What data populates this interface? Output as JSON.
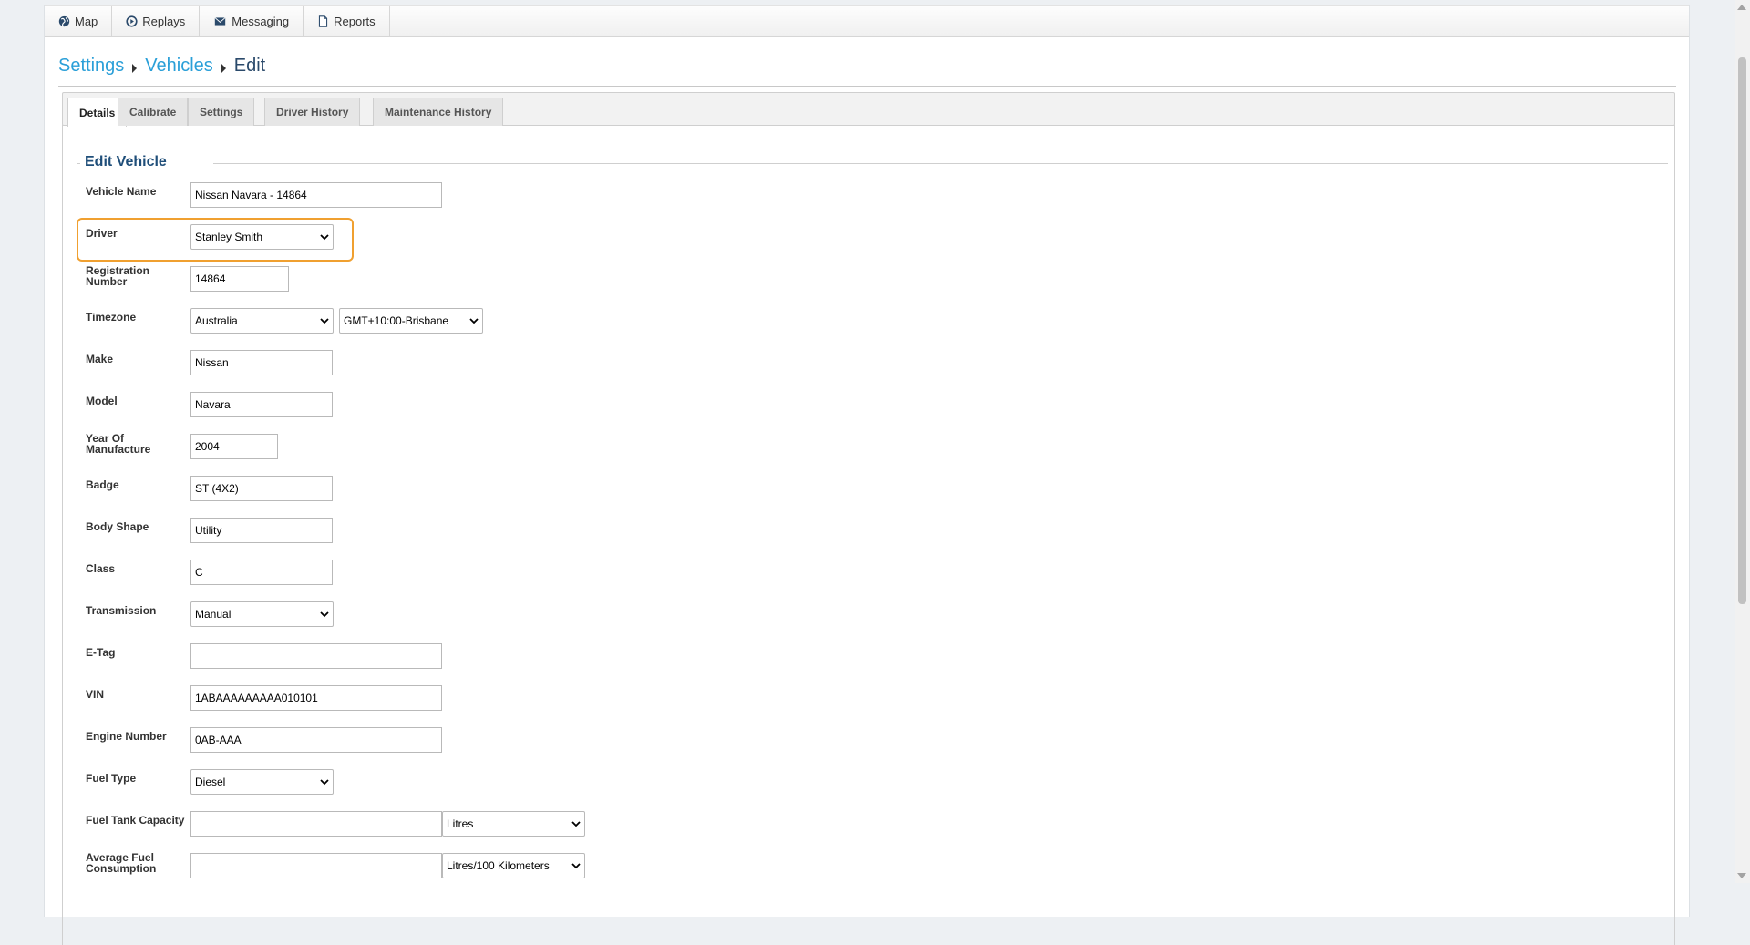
{
  "nav": {
    "items": [
      {
        "label": "Map",
        "icon": "globe-icon"
      },
      {
        "label": "Replays",
        "icon": "play-circle-icon"
      },
      {
        "label": "Messaging",
        "icon": "envelope-icon"
      },
      {
        "label": "Reports",
        "icon": "document-icon"
      }
    ]
  },
  "breadcrumb": {
    "settings": "Settings",
    "vehicles": "Vehicles",
    "current": "Edit"
  },
  "tabs": [
    {
      "label": "Details",
      "active": true
    },
    {
      "label": "Calibrate",
      "active": false
    },
    {
      "label": "Settings",
      "active": false
    },
    {
      "label": "Driver History",
      "active": false
    },
    {
      "label": "Maintenance History",
      "active": false
    }
  ],
  "form": {
    "legend": "Edit Vehicle",
    "vehicle_name": {
      "label": "Vehicle Name",
      "value": "Nissan Navara - 14864"
    },
    "driver": {
      "label": "Driver",
      "value": "Stanley Smith"
    },
    "registration": {
      "label1": "Registration",
      "label2": "Number",
      "value": "14864"
    },
    "timezone": {
      "label": "Timezone",
      "region": "Australia",
      "zone": "GMT+10:00-Brisbane"
    },
    "make": {
      "label": "Make",
      "value": "Nissan"
    },
    "model": {
      "label": "Model",
      "value": "Navara"
    },
    "year": {
      "label1": "Year Of",
      "label2": "Manufacture",
      "value": "2004"
    },
    "badge": {
      "label": "Badge",
      "value": "ST (4X2)"
    },
    "body_shape": {
      "label": "Body Shape",
      "value": "Utility"
    },
    "class": {
      "label": "Class",
      "value": "C"
    },
    "transmission": {
      "label": "Transmission",
      "value": "Manual"
    },
    "etag": {
      "label": "E-Tag",
      "value": ""
    },
    "vin": {
      "label": "VIN",
      "value": "1ABAAAAAAAAA010101"
    },
    "engine_number": {
      "label": "Engine Number",
      "value": "0AB-AAA"
    },
    "fuel_type": {
      "label": "Fuel Type",
      "value": "Diesel"
    },
    "fuel_tank": {
      "label": "Fuel Tank Capacity",
      "value": "",
      "unit": "Litres"
    },
    "avg_fuel": {
      "label1": "Average Fuel",
      "label2": "Consumption",
      "value": "",
      "unit": "Litres/100 Kilometers"
    }
  },
  "colors": {
    "link": "#2a9fd8",
    "legend": "#1f4e79",
    "highlight": "#f0a030"
  }
}
